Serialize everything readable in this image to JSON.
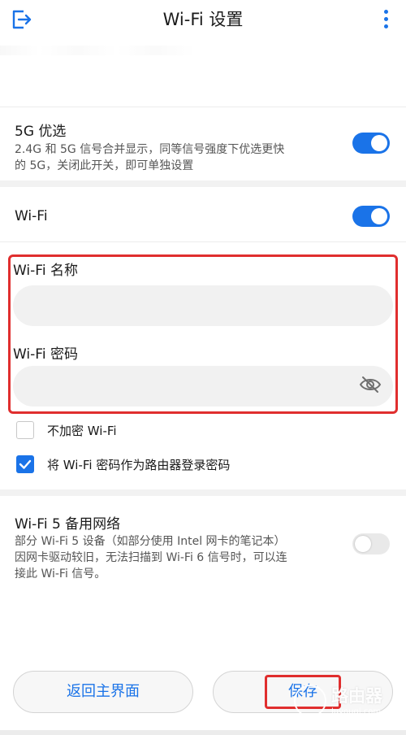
{
  "header": {
    "title": "Wi-Fi 设置",
    "exit_icon": "exit-icon",
    "more_icon": "more-vertical-icon"
  },
  "settings": {
    "band_merge": {
      "label": "5G 优选",
      "description_line1": "2.4G 和 5G 信号合并显示，同等信号强度下优选更快",
      "description_line2": "的 5G，关闭此开关，即可单独设置",
      "enabled": true
    },
    "wifi": {
      "label": "Wi-Fi",
      "enabled": true
    },
    "wifi_name": {
      "label": "Wi-Fi 名称",
      "value": "",
      "placeholder": ""
    },
    "wifi_password": {
      "label": "Wi-Fi 密码",
      "value": "",
      "placeholder": "",
      "visibility_icon": "eye-off-icon"
    },
    "no_encryption": {
      "label": "不加密 Wi-Fi",
      "checked": false
    },
    "use_as_admin_password": {
      "label": "将 Wi-Fi 密码作为路由器登录密码",
      "checked": true
    },
    "wifi5_backup": {
      "label": "Wi-Fi 5 备用网络",
      "description_line1": "部分 Wi-Fi 5 设备（如部分使用 Intel 网卡的笔记本）",
      "description_line2": "因网卡驱动较旧，无法扫描到 Wi-Fi 6 信号时，可以连",
      "description_line3": "接此 Wi-Fi 信号。",
      "enabled": false
    }
  },
  "actions": {
    "back_label": "返回主界面",
    "save_label": "保存"
  },
  "watermark": {
    "text": "路由器",
    "sub": "luyouqi.com"
  },
  "colors": {
    "accent": "#1a73e8",
    "highlight": "#e02e2e"
  }
}
